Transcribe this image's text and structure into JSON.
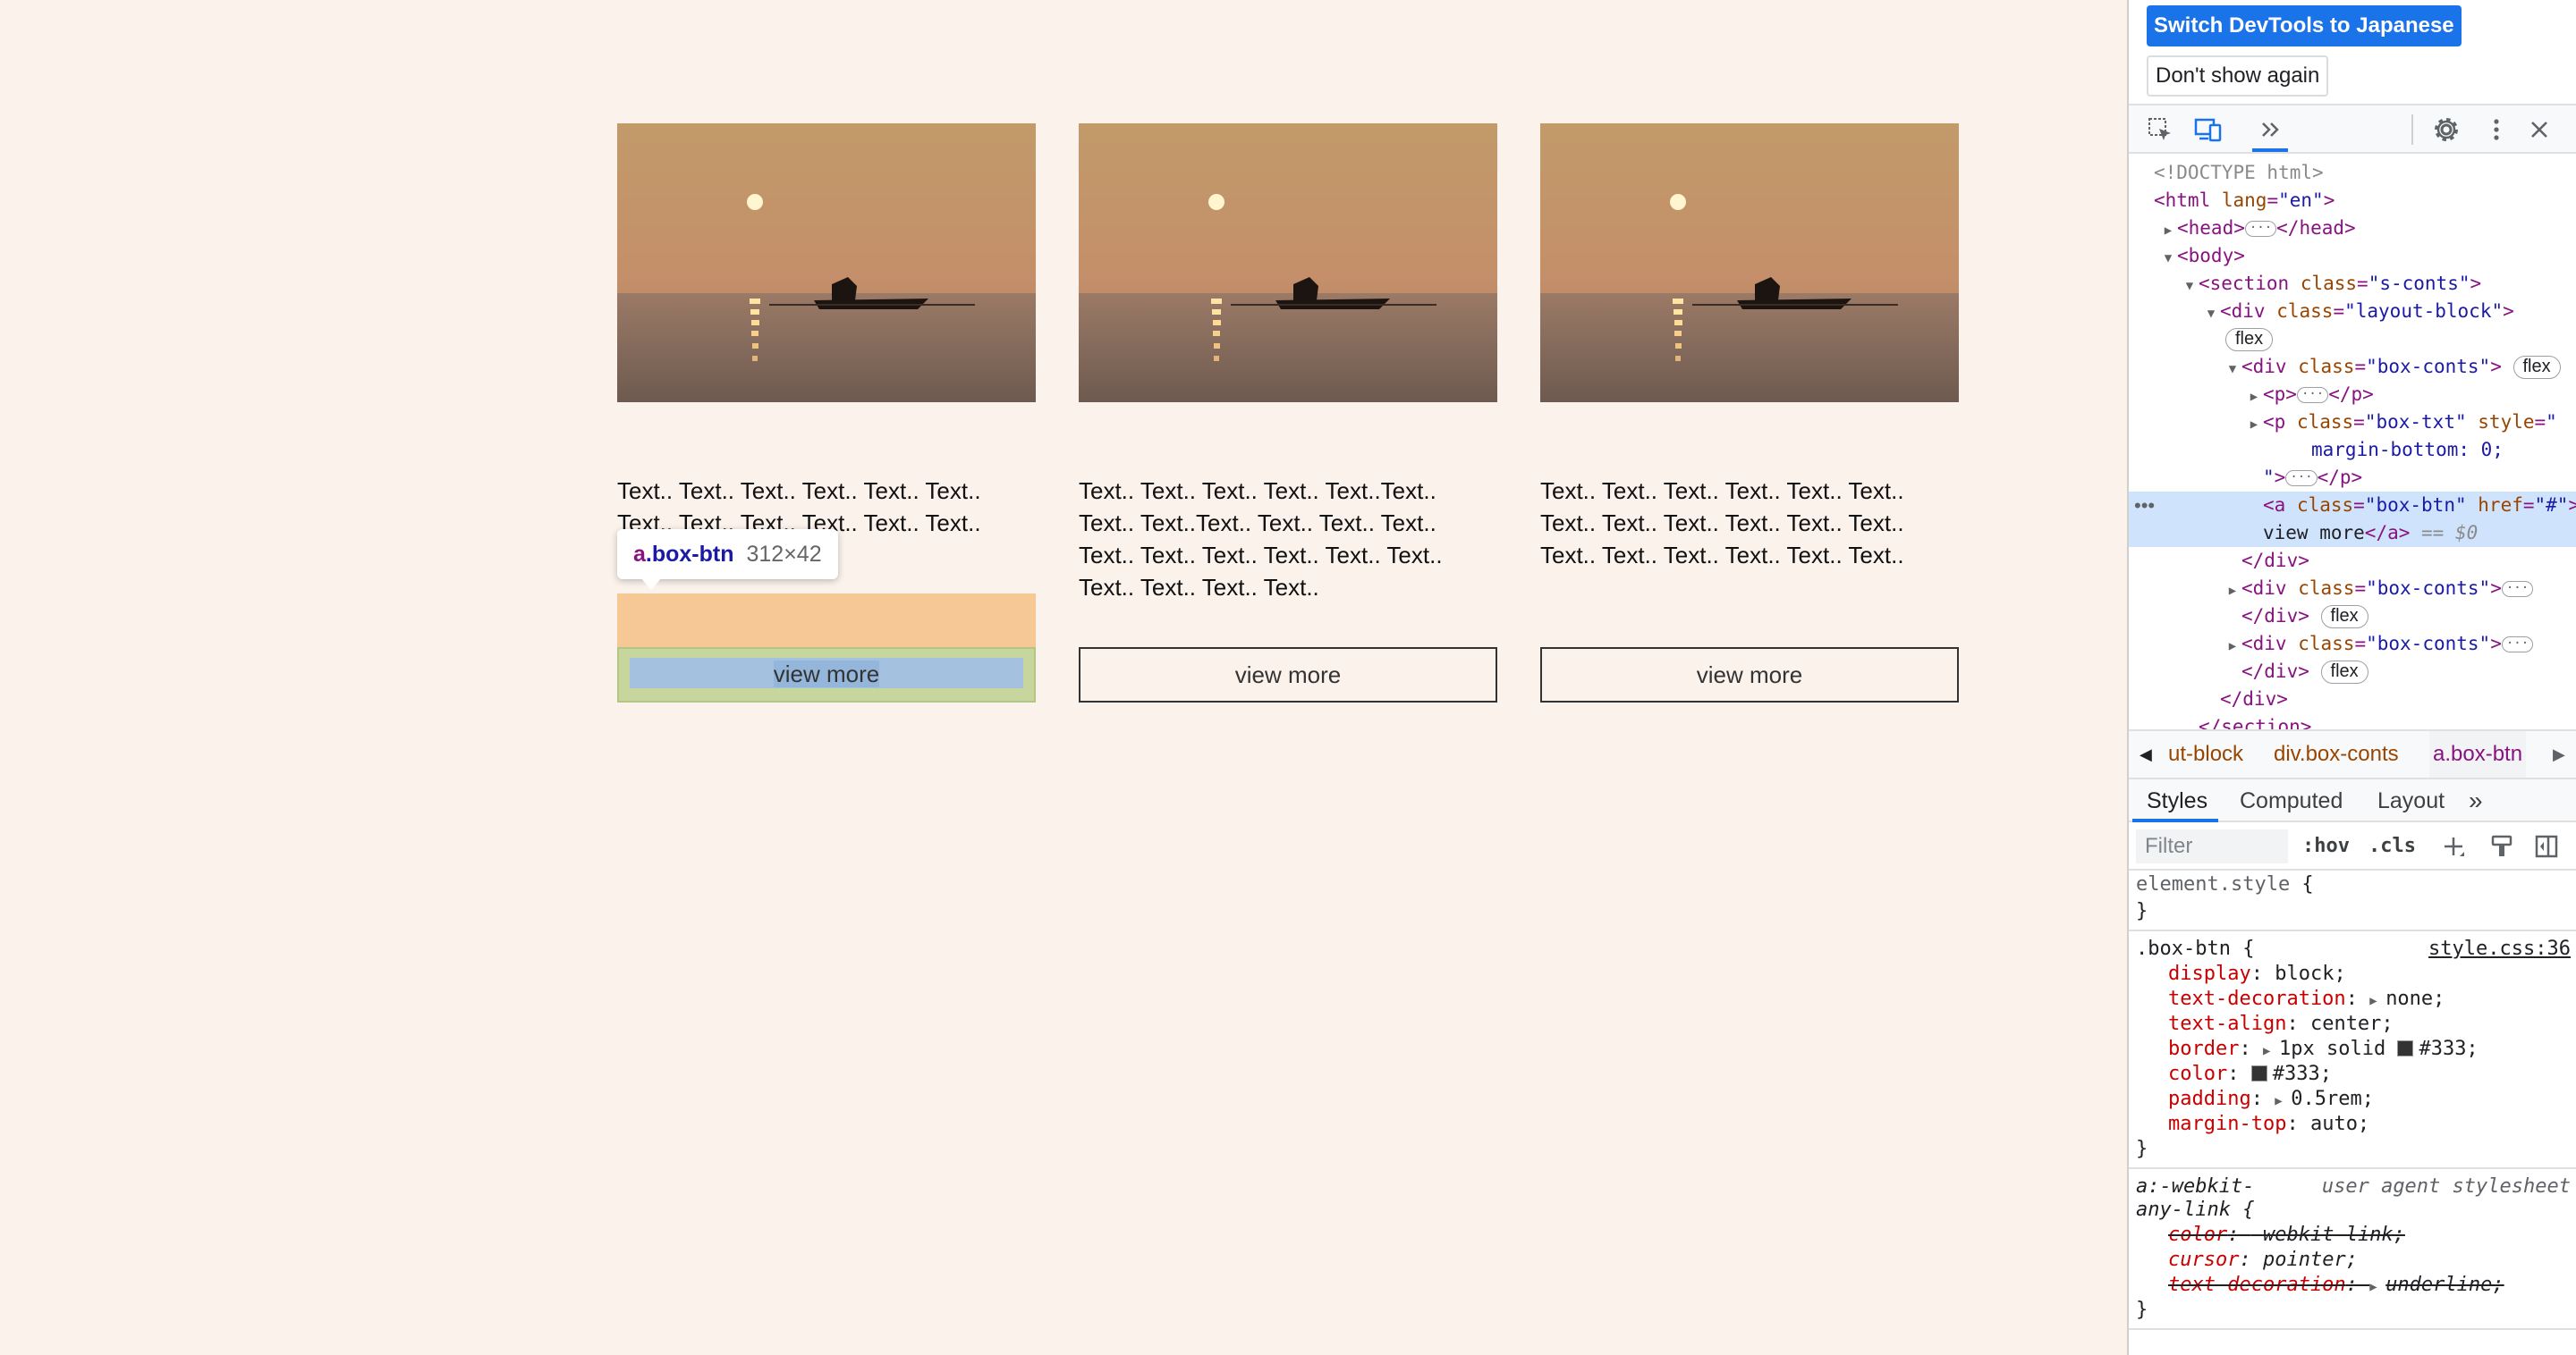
{
  "page": {
    "cards": [
      {
        "text": "Text.. Text.. Text.. Text.. Text.. Text.. Text.. Text.. Text.. Text.. Text.. Text..",
        "button": "view more"
      },
      {
        "text": "Text.. Text.. Text.. Text.. Text..Text.. Text.. Text..Text.. Text.. Text.. Text.. Text.. Text.. Text.. Text.. Text.. Text.. Text.. Text.. Text.. Text..",
        "button": "view more"
      },
      {
        "text": "Text.. Text.. Text.. Text.. Text.. Text.. Text.. Text.. Text.. Text.. Text.. Text.. Text.. Text.. Text.. Text.. Text.. Text..",
        "button": "view more"
      }
    ],
    "tooltip": {
      "tag": "a",
      "class": ".box-btn",
      "size": "312×42"
    }
  },
  "devtools": {
    "notice": {
      "primary": "Switch DevTools to Japanese",
      "secondary": "Don't show again"
    },
    "toolbar": {
      "icons": [
        "inspect-icon",
        "device-toolbar-icon",
        "more-tabs-icon",
        "settings-gear-icon",
        "kebab-menu-icon",
        "close-icon"
      ]
    },
    "dom": {
      "doctype": "<!DOCTYPE html>",
      "html_open": "<html",
      "html_attr": "lang",
      "html_val": "\"en\"",
      "head_open": "<head>",
      "head_close": "</head>",
      "body_open": "<body>",
      "section_open": "<section",
      "section_attr": "class",
      "section_val": "\"s-conts\"",
      "layout_open": "<div",
      "layout_attr": "class",
      "layout_val": "\"layout-block\"",
      "badge_flex": "flex",
      "boxconts_open": "<div",
      "boxconts_attr": "class",
      "boxconts_val": "\"box-conts\"",
      "p_open": "<p>",
      "p_close": "</p>",
      "ptxt_open": "<p",
      "ptxt_attr1": "class",
      "ptxt_val1": "\"box-txt\"",
      "ptxt_attr2": "style",
      "ptxt_val2a": "\"",
      "ptxt_style": "margin-bottom: 0;",
      "ptxt_val2b": "\"",
      "a_open": "<a",
      "a_attr1": "class",
      "a_val1": "\"box-btn\"",
      "a_attr2": "href",
      "a_val2": "\"#\"",
      "a_text": "view more",
      "a_close": "</a>",
      "a_eq": "== $0",
      "div_close": "</div>",
      "section_close": "</section>"
    },
    "breadcrumbs": [
      "ut-block",
      "div.box-conts",
      "a.box-btn"
    ],
    "tabs": [
      "Styles",
      "Computed",
      "Layout"
    ],
    "filter": {
      "placeholder": "Filter",
      "hov": ":hov",
      "cls": ".cls"
    },
    "styles": {
      "element_style": "element.style {",
      "close": "}",
      "rule1_selector": ".box-btn {",
      "rule1_source": "style.css:36",
      "rule1_props": [
        {
          "name": "display",
          "value": "block;"
        },
        {
          "name": "text-decoration",
          "value": "none;"
        },
        {
          "name": "text-align",
          "value": "center;"
        },
        {
          "name": "border",
          "value": "1px solid",
          "color": "#333;"
        },
        {
          "name": "color",
          "value": "#333;"
        },
        {
          "name": "padding",
          "value": "0.5rem;"
        },
        {
          "name": "margin-top",
          "value": "auto;"
        }
      ],
      "rule2_selector_a": "a:-webkit-",
      "rule2_selector_b": "any-link {",
      "rule2_source": "user agent stylesheet",
      "rule2_props": [
        {
          "name": "color",
          "value": "-webkit-link;"
        },
        {
          "name": "cursor",
          "value": "pointer;"
        },
        {
          "name": "text-decoration",
          "value": "underline;"
        }
      ]
    }
  },
  "colors": {
    "page_bg": "#fcf2ec",
    "accent": "#1a73e8",
    "btn_border": "#333333",
    "margin_hl": "#f6c896",
    "padding_hl": "#c6d69c",
    "content_hl": "#a4c2e0"
  }
}
